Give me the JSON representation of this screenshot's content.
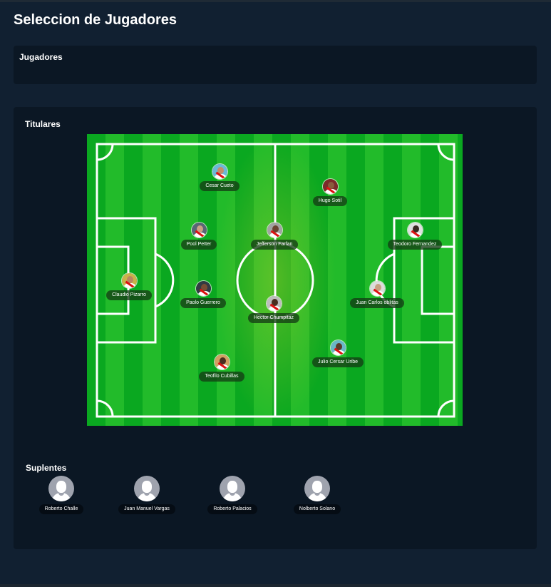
{
  "page": {
    "title": "Seleccion de Jugadores"
  },
  "jugadores_panel": {
    "title": "Jugadores"
  },
  "titulares": {
    "title": "Titulares",
    "players": [
      {
        "name": "Cesar Cueto",
        "skin": "#c58d6a",
        "sky": "#6cb8d8"
      },
      {
        "name": "Hugo Sotil",
        "skin": "#8a5a3c",
        "sky": "#7b2a2a"
      },
      {
        "name": "Pool Petter",
        "skin": "#c9a186",
        "sky": "#5a6575"
      },
      {
        "name": "Jefferson Farfan",
        "skin": "#6b4330",
        "sky": "#a3a3a3"
      },
      {
        "name": "Teodoro Fernandez",
        "skin": "#3a2a22",
        "sky": "#e0e0e0"
      },
      {
        "name": "Claudio Pizarro",
        "skin": "#b98562",
        "sky": "#c9b24a"
      },
      {
        "name": "Paolo Guerrero",
        "skin": "#7a4c34",
        "sky": "#333a44"
      },
      {
        "name": "Hector Chumpitaz",
        "skin": "#4a2e20",
        "sky": "#bdbdbd"
      },
      {
        "name": "Juan Carlos oblitas",
        "skin": "#c7a080",
        "sky": "#dcdcdc"
      },
      {
        "name": "Julio Cersar Uribe",
        "skin": "#5a3a28",
        "sky": "#6ab6c8"
      },
      {
        "name": "Teofilo Cubillas",
        "skin": "#4a2e20",
        "sky": "#d2a063"
      }
    ]
  },
  "suplentes": {
    "title": "Suplentes",
    "players": [
      {
        "name": "Roberto Challe"
      },
      {
        "name": "Juan Manuel Vargas"
      },
      {
        "name": "Roberto Palacios"
      },
      {
        "name": "Nolberto Solano"
      }
    ]
  },
  "colors": {
    "background": "#112031",
    "panel": "#0b1724",
    "pitch_dark": "#0aa820",
    "pitch_light": "#22bb2a",
    "line": "#ffffff"
  }
}
